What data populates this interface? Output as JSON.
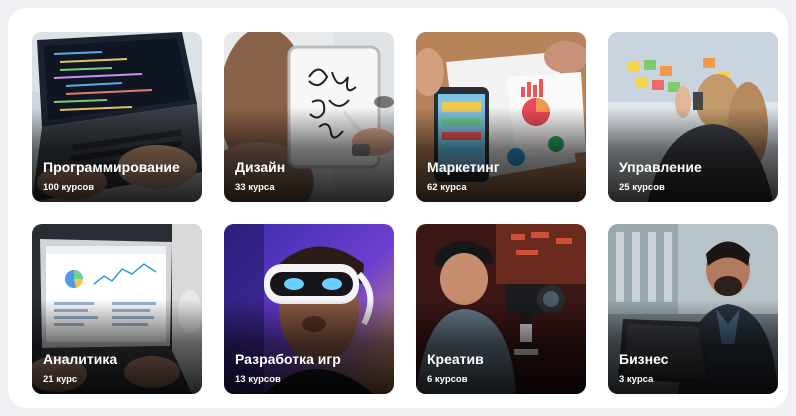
{
  "categories": [
    {
      "title": "Программирование",
      "count": "100 курсов",
      "icon": "laptop-code-photo"
    },
    {
      "title": "Дизайн",
      "count": "33 курса",
      "icon": "tablet-drawing-photo"
    },
    {
      "title": "Маркетинг",
      "count": "62 курса",
      "icon": "charts-on-desk-photo"
    },
    {
      "title": "Управление",
      "count": "25 курсов",
      "icon": "sticky-notes-board-photo"
    },
    {
      "title": "Аналитика",
      "count": "21 курс",
      "icon": "analytics-dashboard-photo"
    },
    {
      "title": "Разработка игр",
      "count": "13 курсов",
      "icon": "vr-headset-photo"
    },
    {
      "title": "Креатив",
      "count": "6 курсов",
      "icon": "video-camera-photo"
    },
    {
      "title": "Бизнес",
      "count": "3 курса",
      "icon": "businessman-laptop-photo"
    }
  ]
}
